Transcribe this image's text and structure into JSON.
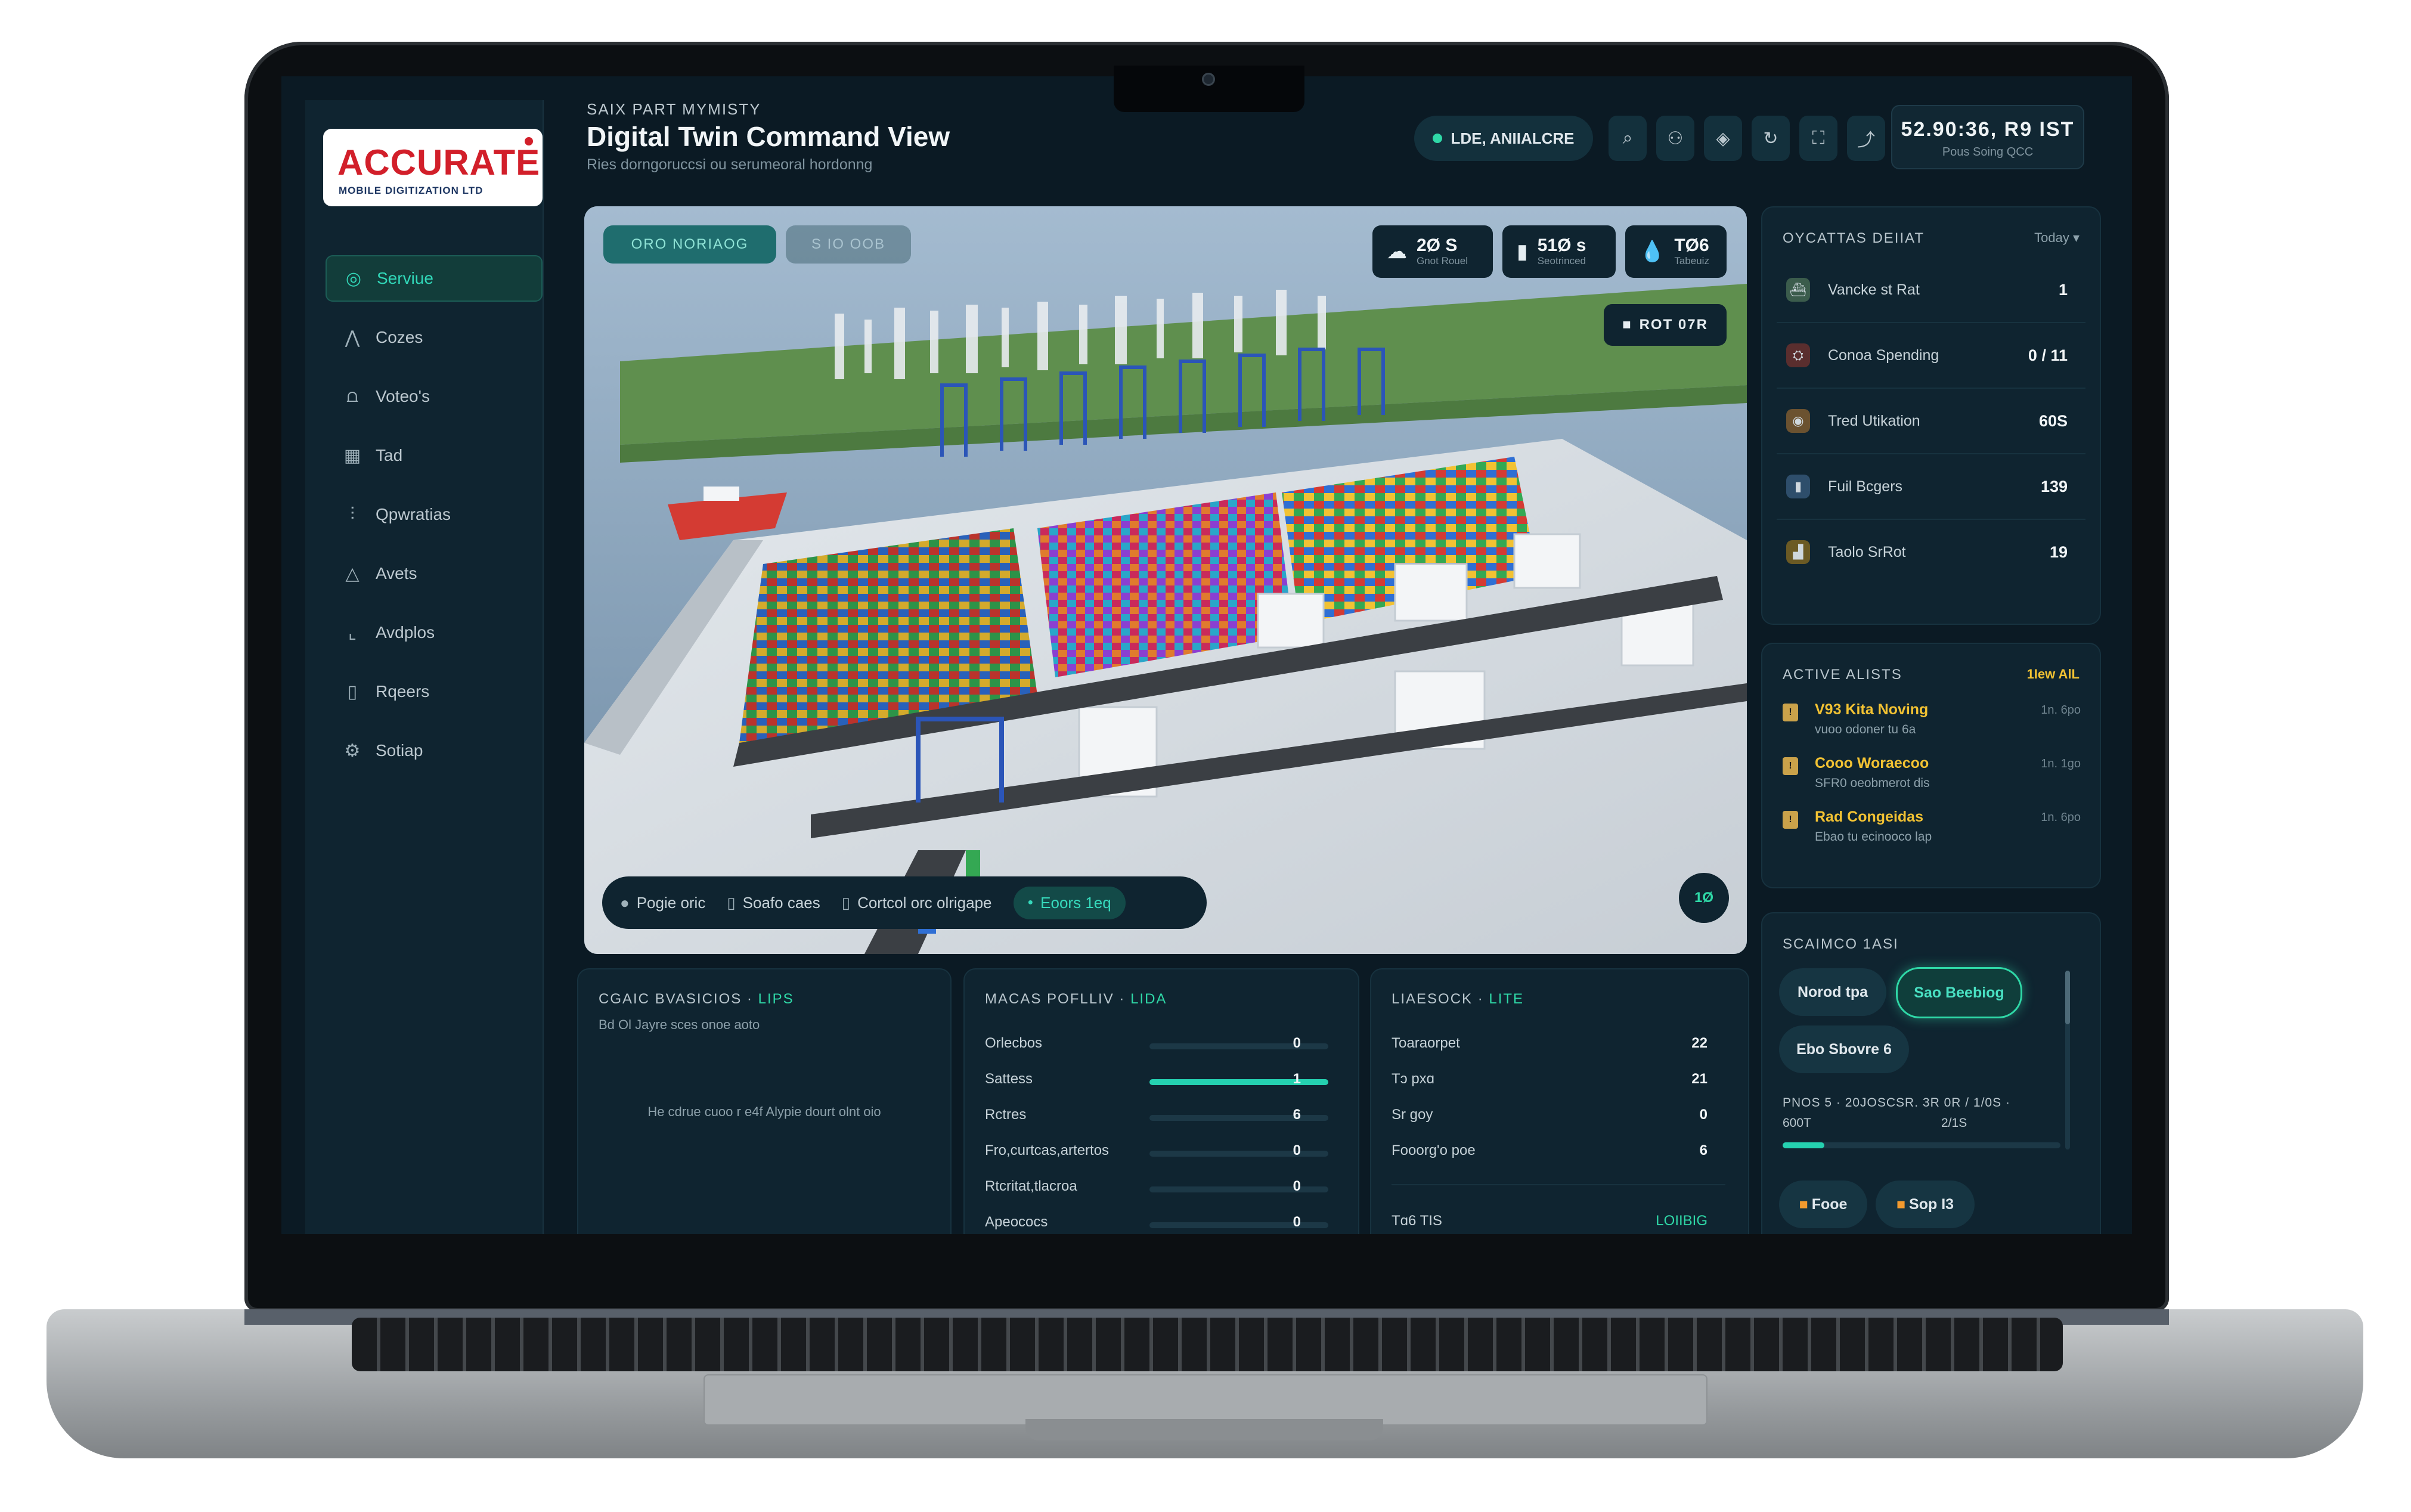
{
  "app": {
    "logo_text": "ACCURATE",
    "logo_sub": "MOBILE DIGITIZATION LTD",
    "breadcrumb": "SAIX PART MYMISTY",
    "title": "Digital Twin Command View",
    "subtitle": "Ries dorngoruccsi ou serumeoral hordonng",
    "live_label": "LDE, ANIIALCRE",
    "clock_time": "52.90:36, R9 IST",
    "clock_sub": "Pous Soing QCC"
  },
  "sidebar": {
    "items": [
      {
        "label": "Serviue",
        "icon": "overview-icon",
        "active": true
      },
      {
        "label": "Cozes",
        "icon": "crane-icon"
      },
      {
        "label": "Voteo's",
        "icon": "vessel-icon"
      },
      {
        "label": "Tad",
        "icon": "yard-icon"
      },
      {
        "label": "Qpwratias",
        "icon": "operations-icon"
      },
      {
        "label": "Avets",
        "icon": "alerts-icon"
      },
      {
        "label": "Avdplos",
        "icon": "analytics-icon"
      },
      {
        "label": "Rqeers",
        "icon": "reports-icon"
      },
      {
        "label": "Sotiap",
        "icon": "settings-icon"
      }
    ]
  },
  "header_icons": [
    "search-icon",
    "user-icon",
    "layers-icon",
    "refresh-icon",
    "fullscreen-icon",
    "share-icon"
  ],
  "view": {
    "tab_a": "ORO NORIAOG",
    "tab_b": "S IO OOB",
    "stats": [
      {
        "value": "2Ø S",
        "label": "Gnot Rouel",
        "icon": "weather-icon"
      },
      {
        "value": "51Ø s",
        "label": "Seotrinced",
        "icon": "wind-icon"
      },
      {
        "value": "TØ6",
        "label": "Tabeuiz",
        "icon": "water-icon"
      }
    ],
    "robot_label": "ROT 07R",
    "bottom_bar": [
      {
        "label": "Pogie oric",
        "icon": "location-icon"
      },
      {
        "label": "Soafo caes",
        "icon": "box-icon"
      },
      {
        "label": "Cortcol orc olrigape",
        "icon": "box-icon"
      },
      {
        "label": "Eoors 1eq",
        "icon": "dot-icon",
        "active": true
      }
    ],
    "fab_label": "1Ø"
  },
  "operations": {
    "title": "OYCATTAS DEIIAT",
    "filter": "Today",
    "rows": [
      {
        "label": "Vancke st Rat",
        "value": "1",
        "icon": "vessel-icon",
        "color": "#3b5c4c"
      },
      {
        "label": "Conoa Spending",
        "value": "0 / 11",
        "icon": "crane-icon",
        "color": "#5a2e2e"
      },
      {
        "label": "Tred Utikation",
        "value": "60S",
        "icon": "yard-icon",
        "color": "#6b5230"
      },
      {
        "label": "Fuil Bcgers",
        "value": "139",
        "icon": "truck-icon",
        "color": "#2e4e6b"
      },
      {
        "label": "Taolo SrRot",
        "value": "19",
        "icon": "chart-icon",
        "color": "#6b5a24"
      }
    ]
  },
  "alerts": {
    "title": "ACTIVE ALISTS",
    "view_all": "1Iew AlL",
    "items": [
      {
        "title": "V93 Kita Noving",
        "sub": "vuoo odoner tu 6a",
        "time": "1n. 6po"
      },
      {
        "title": "Cooo Woraecoo",
        "sub": "SFR0 oeobmerot dis",
        "time": "1n. 1go"
      },
      {
        "title": "Rad Congeidas",
        "sub": "Ebao tu ecinooco lap",
        "time": "1n. 6po"
      }
    ]
  },
  "scenario": {
    "title": "SCAIMCO 1ASI",
    "chips": [
      "Norod tpa",
      "Sao Beebiog",
      "Ebo Sbovre 6"
    ],
    "detail_line1": "PNOS 5 · 20JOSCSR. 3R 0R / 1/0S ·",
    "detail_line2_left": "600T",
    "detail_line2_right": "2/1S",
    "progress": 0.15,
    "buttons": [
      "Fooe",
      "Sop I3"
    ]
  },
  "cargo": {
    "title": "CGAIC BVASICIOS",
    "badge": "LIPS",
    "sub": "Bd Ol Jayre sces onoe aoto",
    "empty": "He cdrue cuoo r e4f Alypie dourt olnt oio"
  },
  "metrics": {
    "title": "MACAS POFLLIV",
    "badge": "LIDA",
    "rows": [
      {
        "label": "Orlecbos",
        "value": "0",
        "fill": 0
      },
      {
        "label": "Sattess",
        "value": "1",
        "fill": 1
      },
      {
        "label": "Rctres",
        "value": "6",
        "fill": 0
      },
      {
        "label": "Fro,curtcas,artertos",
        "value": "0",
        "fill": 0
      },
      {
        "label": "Rtcritat,tlacroa",
        "value": "0",
        "fill": 0
      },
      {
        "label": "Apeococs",
        "value": "0",
        "fill": 0
      }
    ]
  },
  "ledger": {
    "title": "LIAESOCK",
    "badge": "LITE",
    "rows": [
      {
        "label": "Toaraorpet",
        "value": "22"
      },
      {
        "label": "Tɔ pxɑ",
        "value": "21"
      },
      {
        "label": "Sr goy",
        "value": "0"
      },
      {
        "label": "Fooorg'o poe",
        "value": "6"
      }
    ],
    "footer_left": "Tɑ6 TIS",
    "footer_right": "LOIIBIG"
  }
}
